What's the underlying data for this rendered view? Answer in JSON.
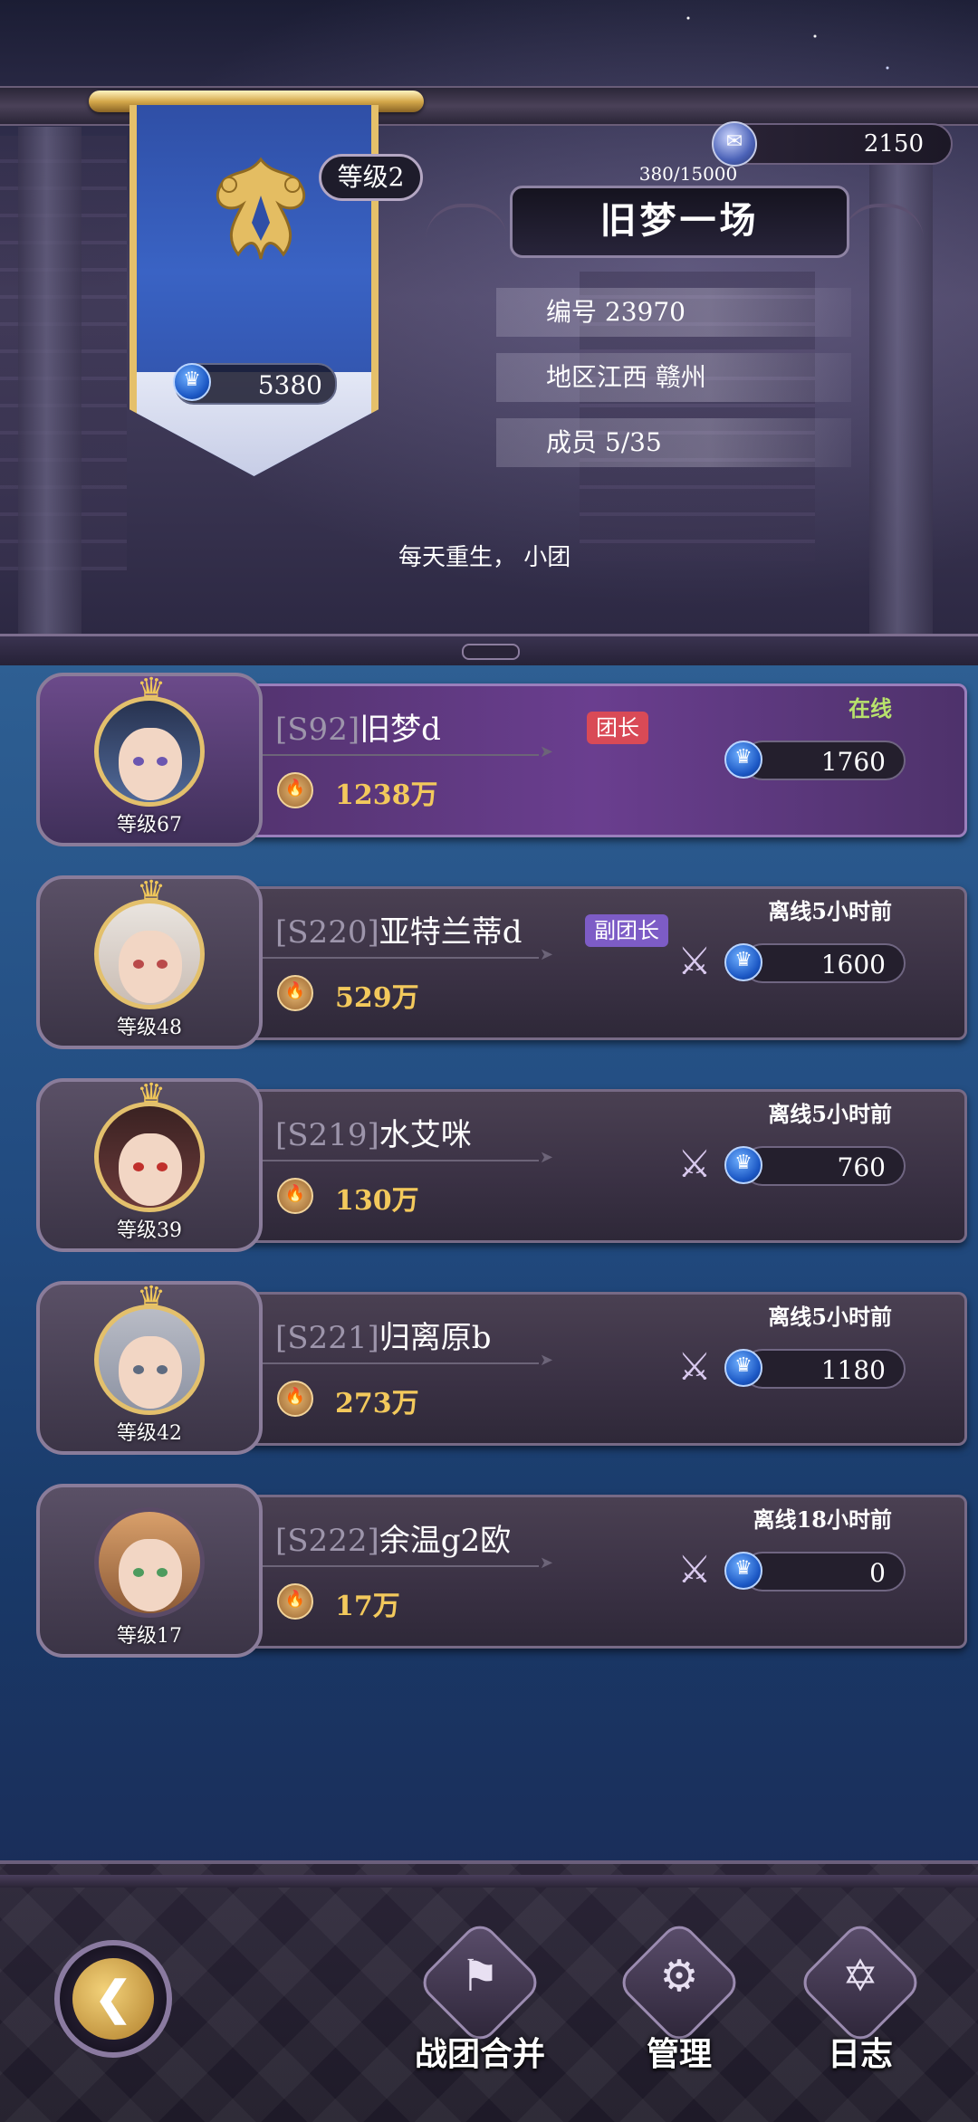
{
  "guild": {
    "level_label": "等级2",
    "name": "旧梦一场",
    "power": "5380",
    "exp": "380/15000",
    "currency": "2150",
    "id_text": "编号 23970",
    "region_text": "地区江西 赣州",
    "members_text": "成员 5/35",
    "motto": "每天重生， 小团"
  },
  "members": [
    {
      "server": "[S92]",
      "name": "旧梦d",
      "level": "等级67",
      "power": "1238万",
      "role": "团长",
      "role_color": "#d94a56",
      "status": "在线",
      "contribution": "1760"
    },
    {
      "server": "[S220]",
      "name": "亚特兰蒂d",
      "level": "等级48",
      "power": "529万",
      "role": "副团长",
      "role_color": "#7d5cc6",
      "status": "离线5小时前",
      "contribution": "1600"
    },
    {
      "server": "[S219]",
      "name": "水艾咪",
      "level": "等级39",
      "power": "130万",
      "role": "",
      "status": "离线5小时前",
      "contribution": "760"
    },
    {
      "server": "[S221]",
      "name": "归离原b",
      "level": "等级42",
      "power": "273万",
      "role": "",
      "status": "离线5小时前",
      "contribution": "1180"
    },
    {
      "server": "[S222]",
      "name": "余温g2欧",
      "level": "等级17",
      "power": "17万",
      "role": "",
      "status": "离线18小时前",
      "contribution": "0"
    }
  ],
  "bottom_nav": {
    "merge_label": "战团合并",
    "manage_label": "管理",
    "log_label": "日志"
  },
  "icons": {
    "back": "back-arrow-icon",
    "merge": "banner-icon",
    "manage": "gears-icon",
    "log": "book-icon",
    "kick": "swords-icon",
    "power": "flame-icon",
    "contribution": "crown-shield-icon",
    "currency": "gem-icon"
  },
  "colors": {
    "online": "#b8e26c",
    "gold_text": "#f3c95c",
    "banner_blue": "#3a63c4",
    "list_bg": "#214a7f"
  }
}
